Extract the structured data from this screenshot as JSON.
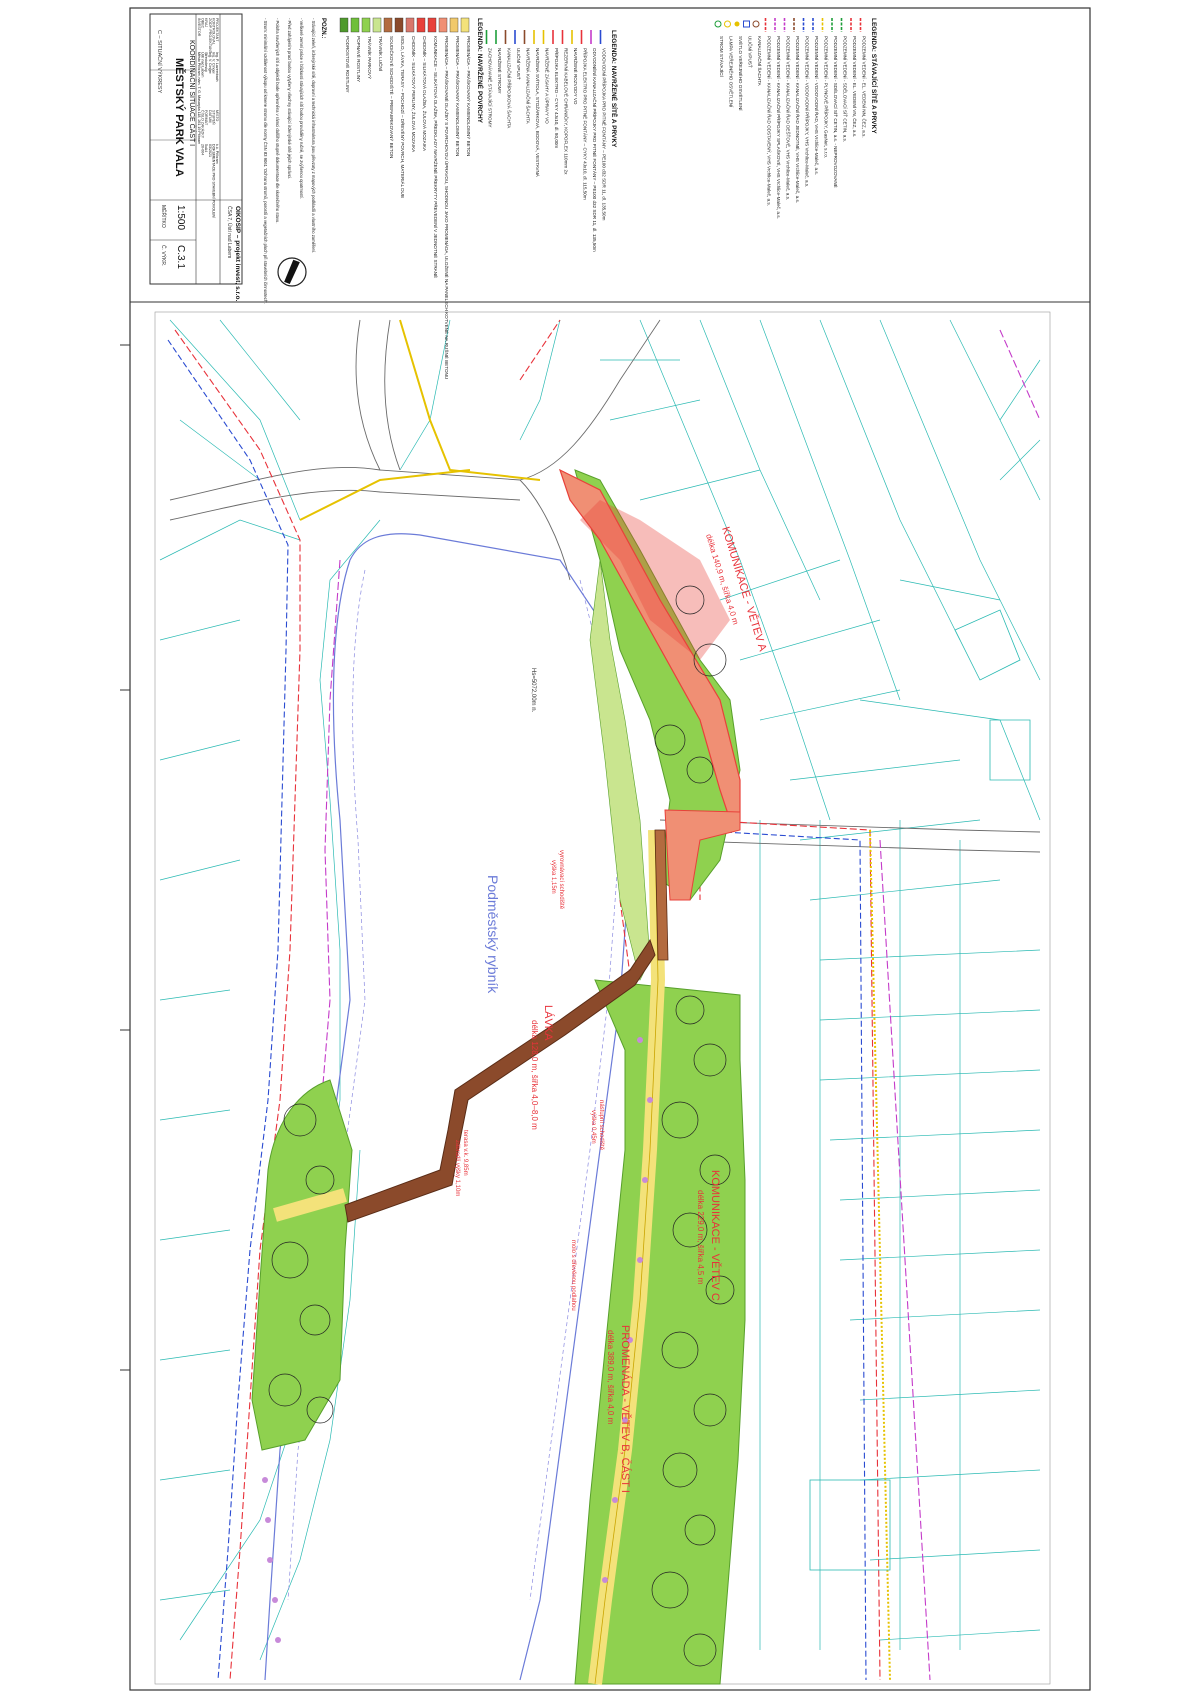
{
  "colors": {
    "frame": "#333333",
    "parcel": "#2bbab3",
    "green_area": "#8fd14f",
    "green_dark": "#58a02b",
    "paving": "#f08f74",
    "paving_dark": "#e8413a",
    "bridge": "#8b4a2b",
    "path_yellow": "#f3e27a",
    "water": "#6b7bd8",
    "util_red": "#e8323a",
    "util_blue": "#2a4bd1",
    "util_magenta": "#c43bc9",
    "util_yellow": "#e6c200",
    "util_green": "#1e9e3a",
    "tree_outline": "#222222",
    "tree_purple": "#c78ad9"
  },
  "legend_utilities": {
    "title": "LEGENDA: STÁVAJÍCÍ SÍTĚ A PRVKY",
    "items": [
      {
        "label": "PODZEMNÍ VEDENÍ - EL. VEDENÍ NN, ČEZ, a.s.",
        "color": "#e8323a",
        "icon": "dash-line"
      },
      {
        "label": "PODZEMNÍ VEDENÍ - EL. VEDENÍ VN, ČEZ, a.s.",
        "color": "#e8323a",
        "icon": "dash-line"
      },
      {
        "label": "PODZEMNÍ VEDENÍ - SDĚLOVACÍ SÍŤ CETIN, a.s.",
        "color": "#1e9e3a",
        "icon": "dash-line"
      },
      {
        "label": "PODZEMNÍ VEDENÍ - SDĚLOVACÍ SÍŤ CETIN, a.s. - NEPROVOZOVANÉ",
        "color": "#1e9e3a",
        "icon": "dash-line"
      },
      {
        "label": "PODZEMNÍ VEDENÍ - PLYNOVÉ PŘÍPOJKY, GasNet, s.r.o.",
        "color": "#e6c200",
        "icon": "dash-line"
      },
      {
        "label": "PODZEMNÍ VEDENÍ - VODOVODNÍ ŘAD, VHS Vrchlice-Maleč, a.s.",
        "color": "#2a4bd1",
        "icon": "dash-line"
      },
      {
        "label": "PODZEMNÍ VEDENÍ - VODOVODNÍ PŘÍPOJKY, VHS Vrchlice-Maleč, a.s.",
        "color": "#2a4bd1",
        "icon": "dash-line"
      },
      {
        "label": "PODZEMNÍ VEDENÍ - KANALIZAČNÍ ŘAD JEDNOTNÉ, VHS Vrchlice-Maleč, a.s.",
        "color": "#8b4a2b",
        "icon": "dash-line"
      },
      {
        "label": "PODZEMNÍ VEDENÍ - KANALIZAČNÍ ŘAD DEŠŤOVÉ, VHS Vrchlice-Maleč, a.s.",
        "color": "#c43bc9",
        "icon": "dash-line"
      },
      {
        "label": "PODZEMNÍ VEDENÍ - KANALIZAČNÍ PŘÍPOJKY SPLAŠKOVÉ, VHS Vrchlice-Maleč, a.s.",
        "color": "#c43bc9",
        "icon": "dash-line"
      },
      {
        "label": "PODZEMNÍ VEDENÍ - KANALIZAČNÍ ŘAD ODSTAVENÝ, VHS Vrchlice-Maleč, a.s.",
        "color": "#e8323a",
        "icon": "dash-line"
      },
      {
        "label": "KANALIZAČNÍ ŠACHTA",
        "color": "#8b4a2b",
        "icon": "circle"
      },
      {
        "label": "ULIČNÍ VPUSŤ",
        "color": "#2a4bd1",
        "icon": "square"
      },
      {
        "label": "SVĚTLO VEŘEJNÉHO OSVĚTLENÍ",
        "color": "#e6c200",
        "icon": "star"
      },
      {
        "label": "LAMPA VEŘEJNÉHO OSVĚTLENÍ",
        "color": "#e6c200",
        "icon": "circle"
      },
      {
        "label": "STROM STÁVAJÍCÍ",
        "color": "#1e9e3a",
        "icon": "circle"
      }
    ]
  },
  "legend_new": {
    "title": "LEGENDA: NAVRŽENÉ SÍTĚ A PRVKY",
    "items": [
      {
        "label": "VODOVODNÍ PŘÍPOJKA PRO PITNÉ FONTÁNY – PE100 d32 SDR 11, dl. 135,50m",
        "color": "#2a4bd1"
      },
      {
        "label": "ODVODNĚNÍ KANALIZAČNÍ PŘÍPOJKY PRO PITNÉ FONTÁNY – PE100 d32 SDR 11, dl. 135,50m",
        "color": "#c43bc9"
      },
      {
        "label": "PŘÍPOJKA ELEKTRO PRO PITNÉ FONTÁNY – CYKY 4Jx10, dl. 115,50m",
        "color": "#e8323a"
      },
      {
        "label": "NAVRŽENÉ ROZVODY VO",
        "color": "#e6c200"
      },
      {
        "label": "REZERVNÍ KABELOVÉ CHRÁNIČKY, KOPOFLEX 110mm 2x",
        "color": "#e8323a"
      },
      {
        "label": "PŘÍPOJKA ELEKTRO – CYKY 4Jx10, dl. 80,00m",
        "color": "#e8323a"
      },
      {
        "label": "NAVRŽENÉ ZÁSAHY A ÚPRAVY VO",
        "color": "#e6c200"
      },
      {
        "label": "NAVRŽENÁ SVÍTIDLA, STOŽÁRKOVÁ, BODOVÁ, VESTAVNÁ",
        "color": "#e6c200"
      },
      {
        "label": "NAVRŽENÁ KANALIZAČNÍ ŠACHTA",
        "color": "#8b4a2b"
      },
      {
        "label": "ULIČNÍ VPUSŤ",
        "color": "#2a4bd1"
      },
      {
        "label": "KANALIZAČNÍ PŘÍPOJKOVÁ ŠACHTA",
        "color": "#8b4a2b"
      },
      {
        "label": "NAVRŽENÉ STROMY",
        "color": "#1e9e3a"
      },
      {
        "label": "ZACHOVÁVANÉ STÁVAJÍCÍ STROMY",
        "color": "#1e9e3a"
      }
    ]
  },
  "legend_surfaces": {
    "title": "LEGENDA: NAVRŽENÉ POVRCHY",
    "items": [
      {
        "label": "PROMENÁDA – PRÁŠKOVANÝ KAMENOLOMNÝ BETON",
        "color": "#f3e27a"
      },
      {
        "label": "PROMENÁDA – PRÁŠKOVANÝ KAMENOLOMNÝ BETON",
        "color": "#f1c96b"
      },
      {
        "label": "PROMENÁDA – PRÁŠKOVANÉ DLAŽBY S POVRCHOVOU ÚPRAVOU, SHODNOU JAKO PROMENÁDA, ULOŽENÉ NA PANELECH KOTVENÉ NA RUŠNÉ BETONU",
        "color": "#f08f74"
      },
      {
        "label": "KOMUNIKACE – SILIKÁTOVÁ DLAŽBA, PŘEDKLADY NAVRŽENÉ PŘEKRYTY PŘEVEDENÍ V JEDNOTNÉ STRANĚ",
        "color": "#e8413a"
      },
      {
        "label": "CHODNÍK – SILIKÁTOVÁ DLAŽBA, ŽULOVÁ MOZAIKA",
        "color": "#e8413a"
      },
      {
        "label": "CHODNÍK – SILIKÁTOVÝ PERLINY, ŽULOVÁ MOZAIKA",
        "color": "#d9776b"
      },
      {
        "label": "MOLO, LÁVKA, TERASY – POCHOZÍ – DŘEVĚNÝ POVRCH, MATERIÁL DUB",
        "color": "#8b4a2b"
      },
      {
        "label": "SOUDIČKOVÉ SCHODIŠTĚ – PREFABRIKOVANÝ BETON",
        "color": "#b36b3f"
      },
      {
        "label": "TRÁVNÍK LUČNÍ",
        "color": "#c9e58f"
      },
      {
        "label": "TRÁVNÍK PARKOVÝ",
        "color": "#8fd14f"
      },
      {
        "label": "POPNAVÉ ROSTLINY",
        "color": "#6fbf3a"
      },
      {
        "label": "PODROSTOVÉ ROSTLINY",
        "color": "#4f9a2c"
      }
    ]
  },
  "notes": {
    "title": "POZN.:",
    "lines": [
      "- Stávající zeleň, inženýrské sítě, dopravní a technická infrastruktura jsou převzaty z mapových podkladů a vlastního zaměření.",
      "- Veškeré zemní práce v blízkosti stávajících sítí budou prováděny ručně, se zvýšenou opatrností.",
      "- Před zahájením prací budou vytyčeny všechny stávající inženýrské sítě jejich správci.",
      "- Poloha navržených sítí a objektů bude upřesněna v rámci dalšího stupně dokumentace dle skutečného stavu.",
      "- Strom: minimální vzdálenost výkopu od kmene stromu dle normy ČSN 83 9061 'Ochrana stromů, porostů a vegetačních ploch při stavebních činnostech'."
    ]
  },
  "title_block": {
    "company": "OIKOSIP – projekt invest, s.r.o.",
    "company_address": "ČSA 7, Ústí nad Labem",
    "rows": [
      {
        "k": "PROJEKTANT",
        "v": "Ing. P. Lazembach"
      },
      {
        "k": "KONTROLOVAL",
        "v": "Ing. V. Cinger"
      },
      {
        "k": "ZODP. PROJEKTANT",
        "v": "Ing. V. Cinger"
      },
      {
        "k": "KRAJ",
        "v": "Středočeský"
      },
      {
        "k": "OBEC",
        "v": "Ústí nad Labem"
      },
      {
        "k": "INVESTOR",
        "v": "Město Příbram, nám. T. G. Masaryka 118, 261 19 Příbram"
      },
      {
        "k": "MÍSTO",
        "v": "k.ú. Příbram"
      },
      {
        "k": "STUPEŇ",
        "v": "DOKUMENTACE PRO STAVEBNÍ POVOLENÍ"
      },
      {
        "k": "DATUM",
        "v": "03/2021"
      },
      {
        "k": "FORMÁT",
        "v": "5xA4"
      },
      {
        "k": "ČÍSLO ZAKÁZKY",
        "v": "20-004"
      }
    ],
    "project_label": "C – SITUAČNÍ VÝKRESY",
    "project_name": "MĚSTSKÝ PARK VALA",
    "drawing_name": "KOORDINAČNÍ SITUACE ČÁST I",
    "scale_label": "MĚŘÍTKO",
    "scale": "1:500",
    "sheet_label": "Č. VÝKR.",
    "sheet": "C.3.1"
  },
  "map": {
    "pond_label": "Podměstský rybník",
    "elevation": "Hs=5072,00m n.",
    "labels": [
      {
        "text": "KOMUNIKACE - VĚTEV A",
        "color": "#e8323a"
      },
      {
        "text": "délka 140,9 m, šířka 4,0 m",
        "color": "#e8323a"
      },
      {
        "text": "LÁVKA",
        "color": "#e8323a"
      },
      {
        "text": "délka 128,0 m, šířka 4,0–8,0 m",
        "color": "#e8323a"
      },
      {
        "text": "PROMENÁDA - VĚTEV B, ČÁST I",
        "color": "#e8323a"
      },
      {
        "text": "délka 389,0 m, šířka 4,0 m",
        "color": "#e8323a"
      },
      {
        "text": "KOMUNIKACE - VĚTEV C",
        "color": "#e8323a"
      },
      {
        "text": "délka 229,0 m, šířka 4,5 m",
        "color": "#e8323a"
      }
    ],
    "annotations": [
      "vyrovnávací schodiště",
      "výška 1,15m",
      "nástupní schodiště",
      "výška 0,45m",
      "molo s dřevěnou podlahou",
      "terasa v.k. 9,85m",
      "zábradlí výšky 1,10m"
    ]
  }
}
